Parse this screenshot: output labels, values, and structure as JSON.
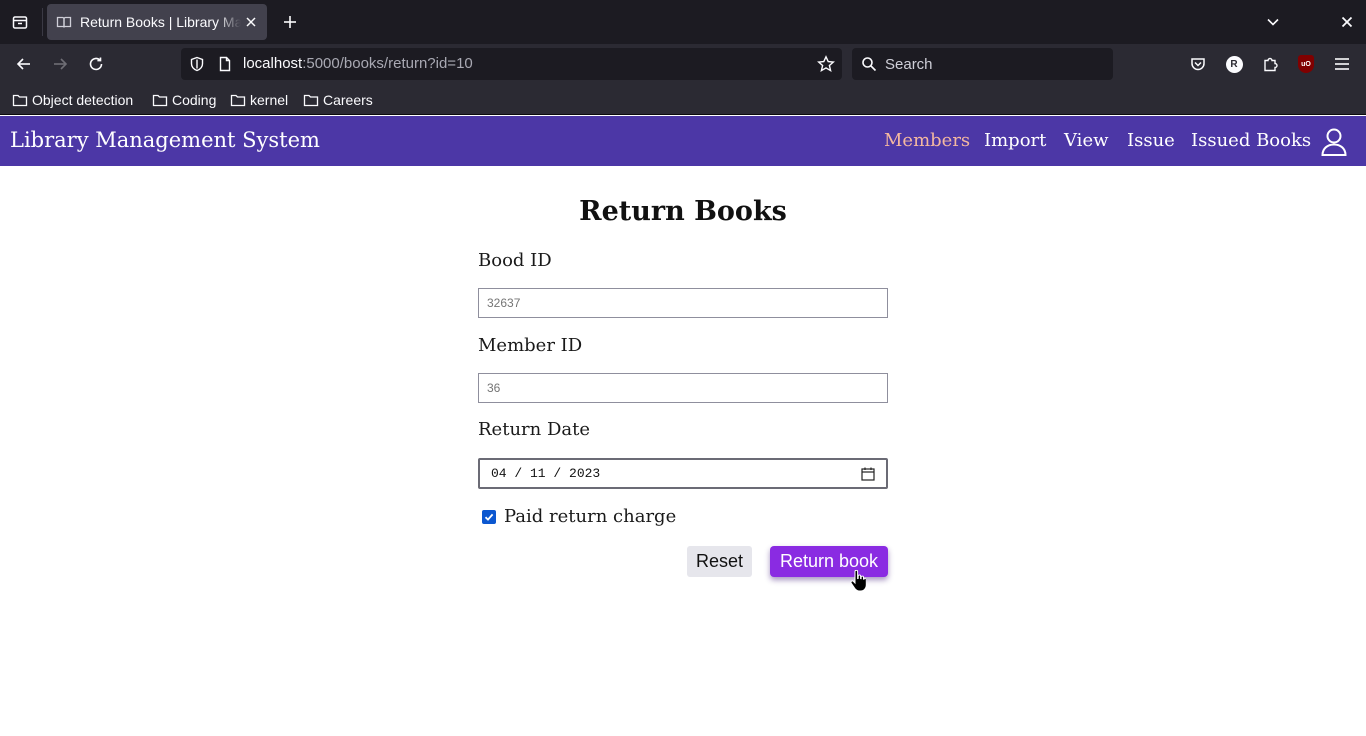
{
  "browser": {
    "tab_title": "Return Books | Library Ma",
    "url_host": "localhost",
    "url_rest": ":5000/books/return?id=10",
    "search_placeholder": "Search",
    "bookmarks": [
      {
        "label": "Object detection"
      },
      {
        "label": "Coding"
      },
      {
        "label": "kernel"
      },
      {
        "label": "Careers"
      }
    ],
    "profile_initial": "R",
    "ublock_text": "uO"
  },
  "header": {
    "brand": "Library Management System",
    "nav": [
      {
        "label": "Members",
        "active": true
      },
      {
        "label": "Import"
      },
      {
        "label": "View"
      },
      {
        "label": "Issue"
      },
      {
        "label": "Issued Books"
      }
    ],
    "accent_color": "#4c37a6",
    "active_color": "#f4b8a0"
  },
  "form": {
    "title": "Return Books",
    "book_id_label": "Bood ID",
    "book_id_placeholder": "32637",
    "member_id_label": "Member ID",
    "member_id_placeholder": "36",
    "return_date_label": "Return Date",
    "return_date_value": "04 / 11 / 2023",
    "paid_charge_label": "Paid return charge",
    "paid_charge_checked": true,
    "reset_label": "Reset",
    "submit_label": "Return book",
    "submit_color": "#8a2be2"
  }
}
